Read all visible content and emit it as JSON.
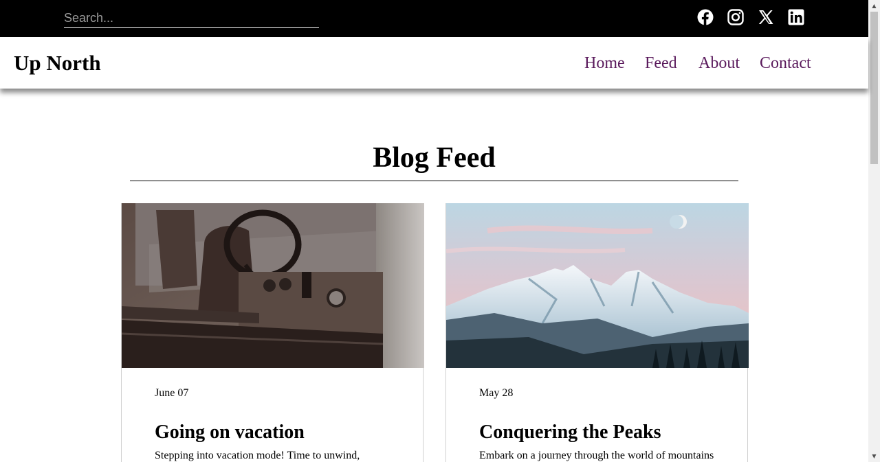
{
  "topbar": {
    "search_placeholder": "Search...",
    "social": [
      {
        "icon": "facebook-icon",
        "label": "Facebook"
      },
      {
        "icon": "instagram-icon",
        "label": "Instagram"
      },
      {
        "icon": "x-icon",
        "label": "X"
      },
      {
        "icon": "linkedin-icon",
        "label": "LinkedIn"
      }
    ]
  },
  "header": {
    "brand": "Up North",
    "nav": [
      "Home",
      "Feed",
      "About",
      "Contact"
    ],
    "nav_color": "#5a1a5c"
  },
  "main": {
    "title": "Blog Feed",
    "posts": [
      {
        "date": "June 07",
        "title": "Going on vacation",
        "excerpt": "Stepping into vacation mode! Time to unwind,",
        "image": "vintage-truck-interior-photo"
      },
      {
        "date": "May 28",
        "title": "Conquering the Peaks",
        "excerpt": "Embark on a journey through the world of mountains",
        "image": "snowy-mountain-photo"
      }
    ]
  },
  "colors": {
    "topbar_bg": "#000000",
    "accent": "#5a1a5c"
  }
}
